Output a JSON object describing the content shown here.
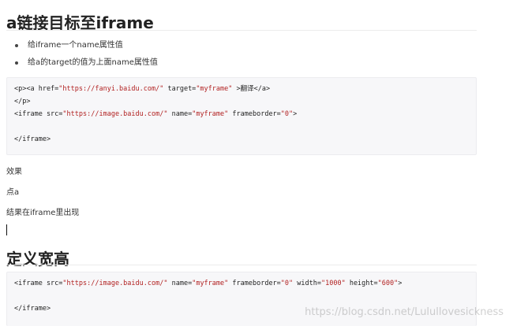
{
  "section1": {
    "heading": "a链接目标至iframe",
    "bullets": [
      "给iframe一个name属性值",
      "给a的target的值为上面name属性值"
    ]
  },
  "code1": {
    "l1_open": "<p><a href=",
    "l1_href": "\"https://fanyi.baidu.com/\"",
    "l1_target_attr": " target=",
    "l1_target": "\"myframe\"",
    "l1_close_text": " >翻译</a>",
    "l2": "</p>",
    "l3_open": "<iframe src=",
    "l3_src": "\"https://image.baidu.com/\"",
    "l3_name_attr": " name=",
    "l3_name": "\"myframe\"",
    "l3_fb_attr": " frameborder=",
    "l3_fb": "\"0\"",
    "l3_end": ">",
    "l5": "</iframe>"
  },
  "paragraphs": [
    "效果",
    "点a",
    "结果在iframe里出现"
  ],
  "section2": {
    "heading": "定义宽高"
  },
  "code2": {
    "l1_open": "<iframe src=",
    "l1_src": "\"https://image.baidu.com/\"",
    "l1_name_attr": " name=",
    "l1_name": "\"myframe\"",
    "l1_fb_attr": " frameborder=",
    "l1_fb": "\"0\"",
    "l1_w_attr": " width=",
    "l1_w": "\"1000\"",
    "l1_h_attr": " height=",
    "l1_h": "\"600\"",
    "l1_end": ">",
    "l3": "</iframe>"
  },
  "watermark": "https://blog.csdn.net/Lulullovesickness"
}
